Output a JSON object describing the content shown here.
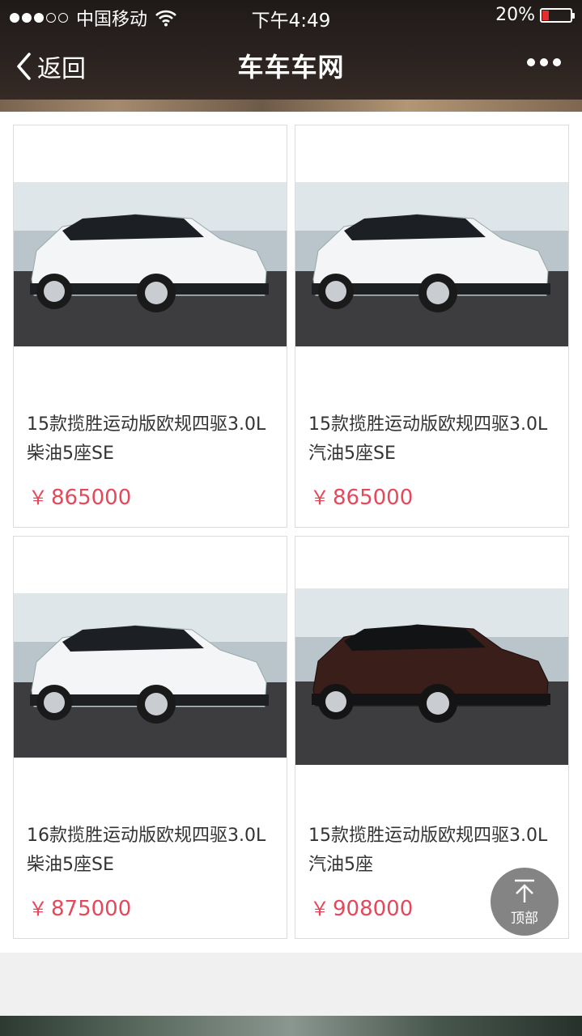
{
  "status_bar": {
    "carrier": "中国移动",
    "time": "下午4:49",
    "battery": "20%",
    "battery_level": 0.2
  },
  "nav": {
    "back_label": "返回",
    "title": "车车车网"
  },
  "products": [
    {
      "title": "15款揽胜运动版欧规四驱3.0L柴油5座SE",
      "currency": "￥",
      "price": "865000",
      "car_color": "white"
    },
    {
      "title": "15款揽胜运动版欧规四驱3.0L汽油5座SE",
      "currency": "￥",
      "price": "865000",
      "car_color": "white"
    },
    {
      "title": "16款揽胜运动版欧规四驱3.0L柴油5座SE",
      "currency": "￥",
      "price": "875000",
      "car_color": "white"
    },
    {
      "title": "15款揽胜运动版欧规四驱3.0L汽油5座",
      "currency": "￥",
      "price": "908000",
      "car_color": "dark-brown"
    }
  ],
  "back_to_top": {
    "label": "顶部"
  },
  "colors": {
    "price": "#e8475a",
    "header_bg": "#2a2220",
    "battery_low": "#e82b2b"
  }
}
